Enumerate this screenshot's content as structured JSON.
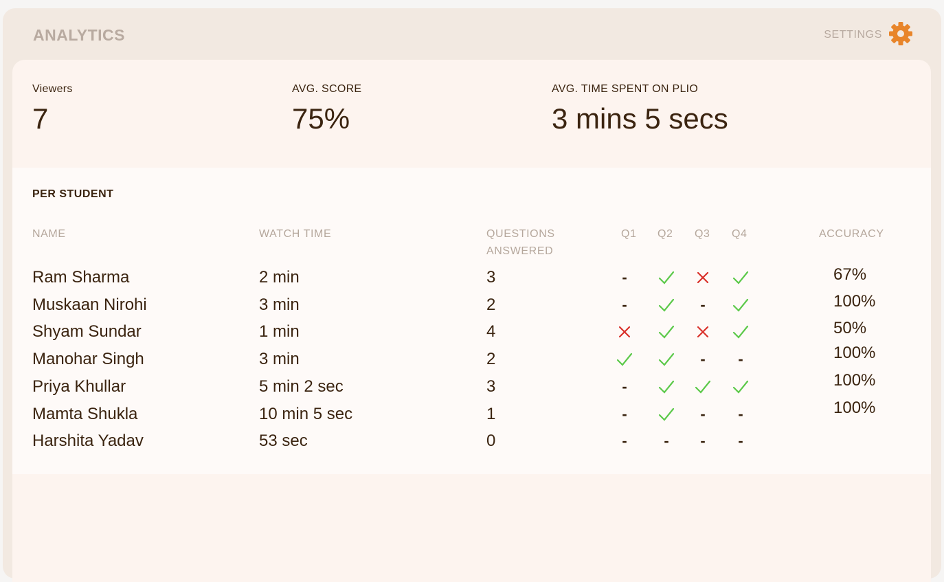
{
  "header": {
    "title": "ANALYTICS",
    "settings_label": "SETTINGS"
  },
  "summary": {
    "viewers_label": "Viewers",
    "viewers_value": "7",
    "avg_score_label": "AVG. SCORE",
    "avg_score_value": "75%",
    "avg_time_label": "AVG. TIME SPENT ON PLIO",
    "avg_time_value": "3 mins 5 secs"
  },
  "per_student": {
    "title": "PER STUDENT",
    "columns": {
      "name": "NAME",
      "watch_time": "WATCH TIME",
      "questions_answered": "QUESTIONS ANSWERED",
      "q1": "Q1",
      "q2": "Q2",
      "q3": "Q3",
      "q4": "Q4",
      "accuracy": "ACCURACY"
    },
    "rows": [
      {
        "name": "Ram Sharma",
        "watch_time": "2 min",
        "answered": "3",
        "q": [
          "-",
          "correct",
          "wrong",
          "correct"
        ],
        "accuracy": "67%"
      },
      {
        "name": "Muskaan Nirohi",
        "watch_time": "3 min",
        "answered": "2",
        "q": [
          "-",
          "correct",
          "-",
          "correct"
        ],
        "accuracy": "100%"
      },
      {
        "name": "Shyam Sundar",
        "watch_time": "1 min",
        "answered": "4",
        "q": [
          "wrong",
          "correct",
          "wrong",
          "correct"
        ],
        "accuracy": "50%"
      },
      {
        "name": "Manohar Singh",
        "watch_time": "3 min",
        "answered": "2",
        "q": [
          "correct",
          "correct",
          "-",
          "-"
        ],
        "accuracy": "100%"
      },
      {
        "name": "Priya Khullar",
        "watch_time": "5 min 2 sec",
        "answered": "3",
        "q": [
          "-",
          "correct",
          "correct",
          "correct"
        ],
        "accuracy": "100%"
      },
      {
        "name": "Mamta Shukla",
        "watch_time": "10 min 5 sec",
        "answered": "1",
        "q": [
          "-",
          "correct",
          "-",
          "-"
        ],
        "accuracy": "100%"
      },
      {
        "name": "Harshita Yadav",
        "watch_time": "53 sec",
        "answered": "0",
        "q": [
          "-",
          "-",
          "-",
          "-"
        ],
        "accuracy": ""
      }
    ]
  },
  "colors": {
    "correct": "#5cc94a",
    "wrong": "#d9312b",
    "accent": "#e8852a",
    "text": "#3b2410"
  },
  "icons": {
    "settings": "gear-icon",
    "correct": "check-icon",
    "wrong": "cross-icon",
    "unanswered": "dash"
  }
}
